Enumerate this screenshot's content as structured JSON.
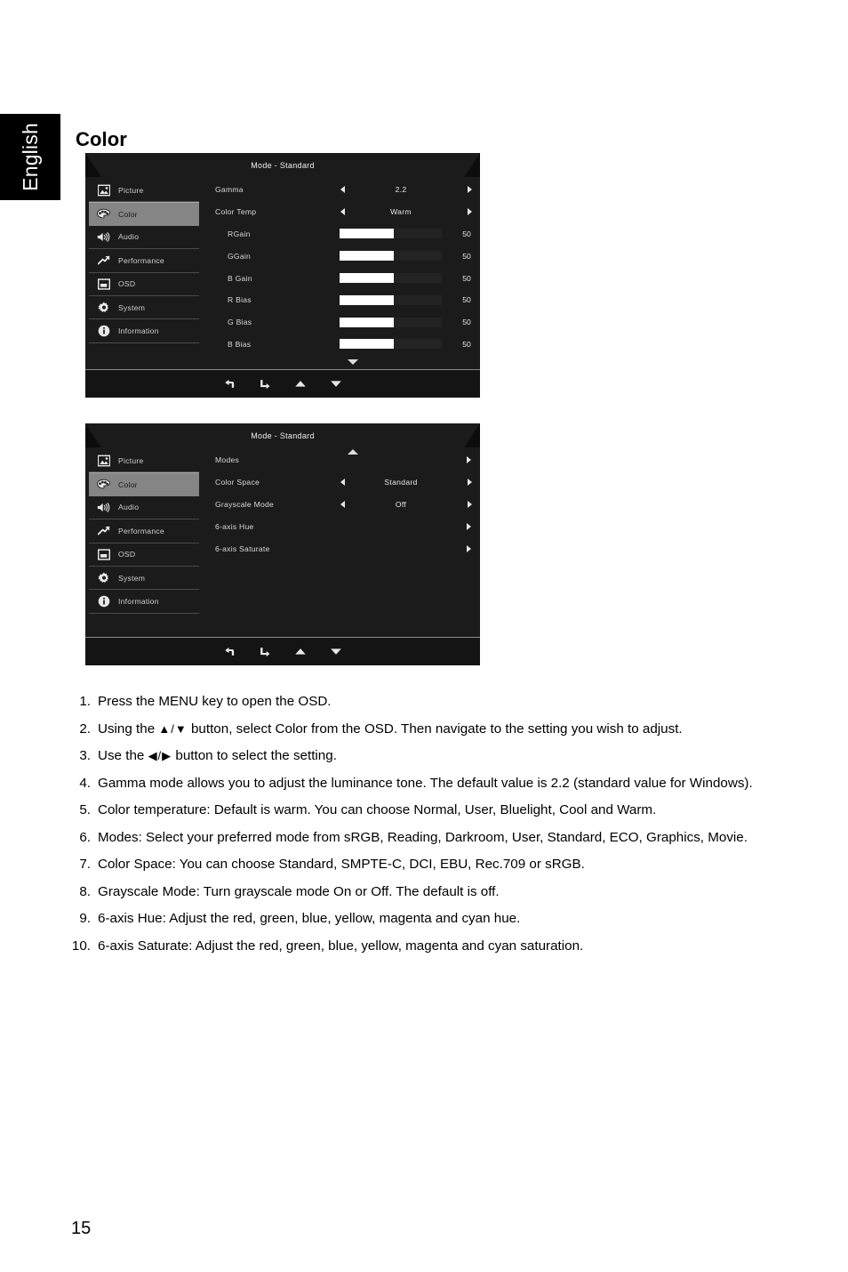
{
  "page": {
    "language_tab": "English",
    "heading": "Color",
    "page_number": "15"
  },
  "osd_menus": [
    {
      "id": "color-menu-page-1",
      "title": "Mode - Standard",
      "nav": [
        {
          "label": "Picture",
          "icon": "picture-icon",
          "selected": false
        },
        {
          "label": "Color",
          "icon": "palette-icon",
          "selected": true
        },
        {
          "label": "Audio",
          "icon": "speaker-icon",
          "selected": false
        },
        {
          "label": "Performance",
          "icon": "trend-up-icon",
          "selected": false
        },
        {
          "label": "OSD",
          "icon": "osd-screen-icon",
          "selected": false
        },
        {
          "label": "System",
          "icon": "gear-icon",
          "selected": false
        },
        {
          "label": "Information",
          "icon": "info-icon",
          "selected": false
        }
      ],
      "settings": [
        {
          "type": "value",
          "label": "Gamma",
          "value": "2.2",
          "sub": false
        },
        {
          "type": "value",
          "label": "Color Temp",
          "value": "Warm",
          "sub": false
        },
        {
          "type": "slider",
          "label": "RGain",
          "value": "50",
          "fill_percent": 53,
          "sub": true
        },
        {
          "type": "slider",
          "label": "GGain",
          "value": "50",
          "fill_percent": 53,
          "sub": true
        },
        {
          "type": "slider",
          "label": "B Gain",
          "value": "50",
          "fill_percent": 53,
          "sub": true
        },
        {
          "type": "slider",
          "label": "R Bias",
          "value": "50",
          "fill_percent": 53,
          "sub": true
        },
        {
          "type": "slider",
          "label": "G Bias",
          "value": "50",
          "fill_percent": 53,
          "sub": true
        },
        {
          "type": "slider",
          "label": "B Bias",
          "value": "50",
          "fill_percent": 53,
          "sub": true
        }
      ],
      "scroll_indicator": "down",
      "footer_icons": [
        "back-arrow-icon",
        "enter-arrow-icon",
        "up-arrow-icon",
        "down-arrow-icon"
      ]
    },
    {
      "id": "color-menu-page-2",
      "title": "Mode - Standard",
      "nav": [
        {
          "label": "Picture",
          "icon": "picture-icon",
          "selected": false
        },
        {
          "label": "Color",
          "icon": "palette-icon",
          "selected": true
        },
        {
          "label": "Audio",
          "icon": "speaker-icon",
          "selected": false
        },
        {
          "label": "Performance",
          "icon": "trend-up-icon",
          "selected": false
        },
        {
          "label": "OSD",
          "icon": "osd-screen-icon",
          "selected": false
        },
        {
          "label": "System",
          "icon": "gear-icon",
          "selected": false
        },
        {
          "label": "Information",
          "icon": "info-icon",
          "selected": false
        }
      ],
      "settings": [
        {
          "type": "submenu",
          "label": "Modes",
          "value": "",
          "sub": false
        },
        {
          "type": "value",
          "label": "Color Space",
          "value": "Standard",
          "sub": false
        },
        {
          "type": "value",
          "label": "Grayscale Mode",
          "value": "Off",
          "sub": false
        },
        {
          "type": "submenu",
          "label": "6-axis Hue",
          "value": "",
          "sub": false
        },
        {
          "type": "submenu",
          "label": "6-axis Saturate",
          "value": "",
          "sub": false
        }
      ],
      "scroll_indicator": "up",
      "footer_icons": [
        "back-arrow-icon",
        "enter-arrow-icon",
        "up-arrow-icon",
        "down-arrow-icon"
      ]
    }
  ],
  "instructions": [
    {
      "num": "1.",
      "text": "Press the MENU key to open the OSD."
    },
    {
      "num": "2.",
      "text_before": "Using the ",
      "glyph": "▲/▼",
      "text_after": " button, select Color from the OSD. Then navigate to the setting you wish to adjust."
    },
    {
      "num": "3.",
      "text_before": "Use the ",
      "glyph": "◀/▶",
      "text_after": " button to select the setting."
    },
    {
      "num": "4.",
      "text": "Gamma mode allows you to adjust the luminance tone. The default value is 2.2 (standard value for Windows)."
    },
    {
      "num": "5.",
      "text": "Color temperature: Default is warm. You can choose Normal, User, Bluelight, Cool and Warm."
    },
    {
      "num": "6.",
      "text": "Modes: Select your preferred mode from sRGB, Reading, Darkroom, User, Standard, ECO, Graphics, Movie."
    },
    {
      "num": "7.",
      "text": "Color Space: You can choose Standard, SMPTE-C, DCI, EBU, Rec.709 or sRGB."
    },
    {
      "num": "8.",
      "text": "Grayscale Mode: Turn grayscale mode On or Off. The default is off."
    },
    {
      "num": "9.",
      "text": "6-axis Hue: Adjust the red, green, blue, yellow, magenta and cyan hue."
    },
    {
      "num": "10.",
      "text": "6-axis Saturate: Adjust the red, green, blue, yellow, magenta and cyan saturation."
    }
  ],
  "colors": {
    "osd_background": "#1b1b1b",
    "osd_header": "#0c0c0c",
    "osd_selected_item": "#858585",
    "osd_text": "#d8d8d8",
    "slider_fill": "#ffffff",
    "slider_track": "#232323",
    "language_tab_background": "#000000",
    "page_background": "#ffffff"
  }
}
